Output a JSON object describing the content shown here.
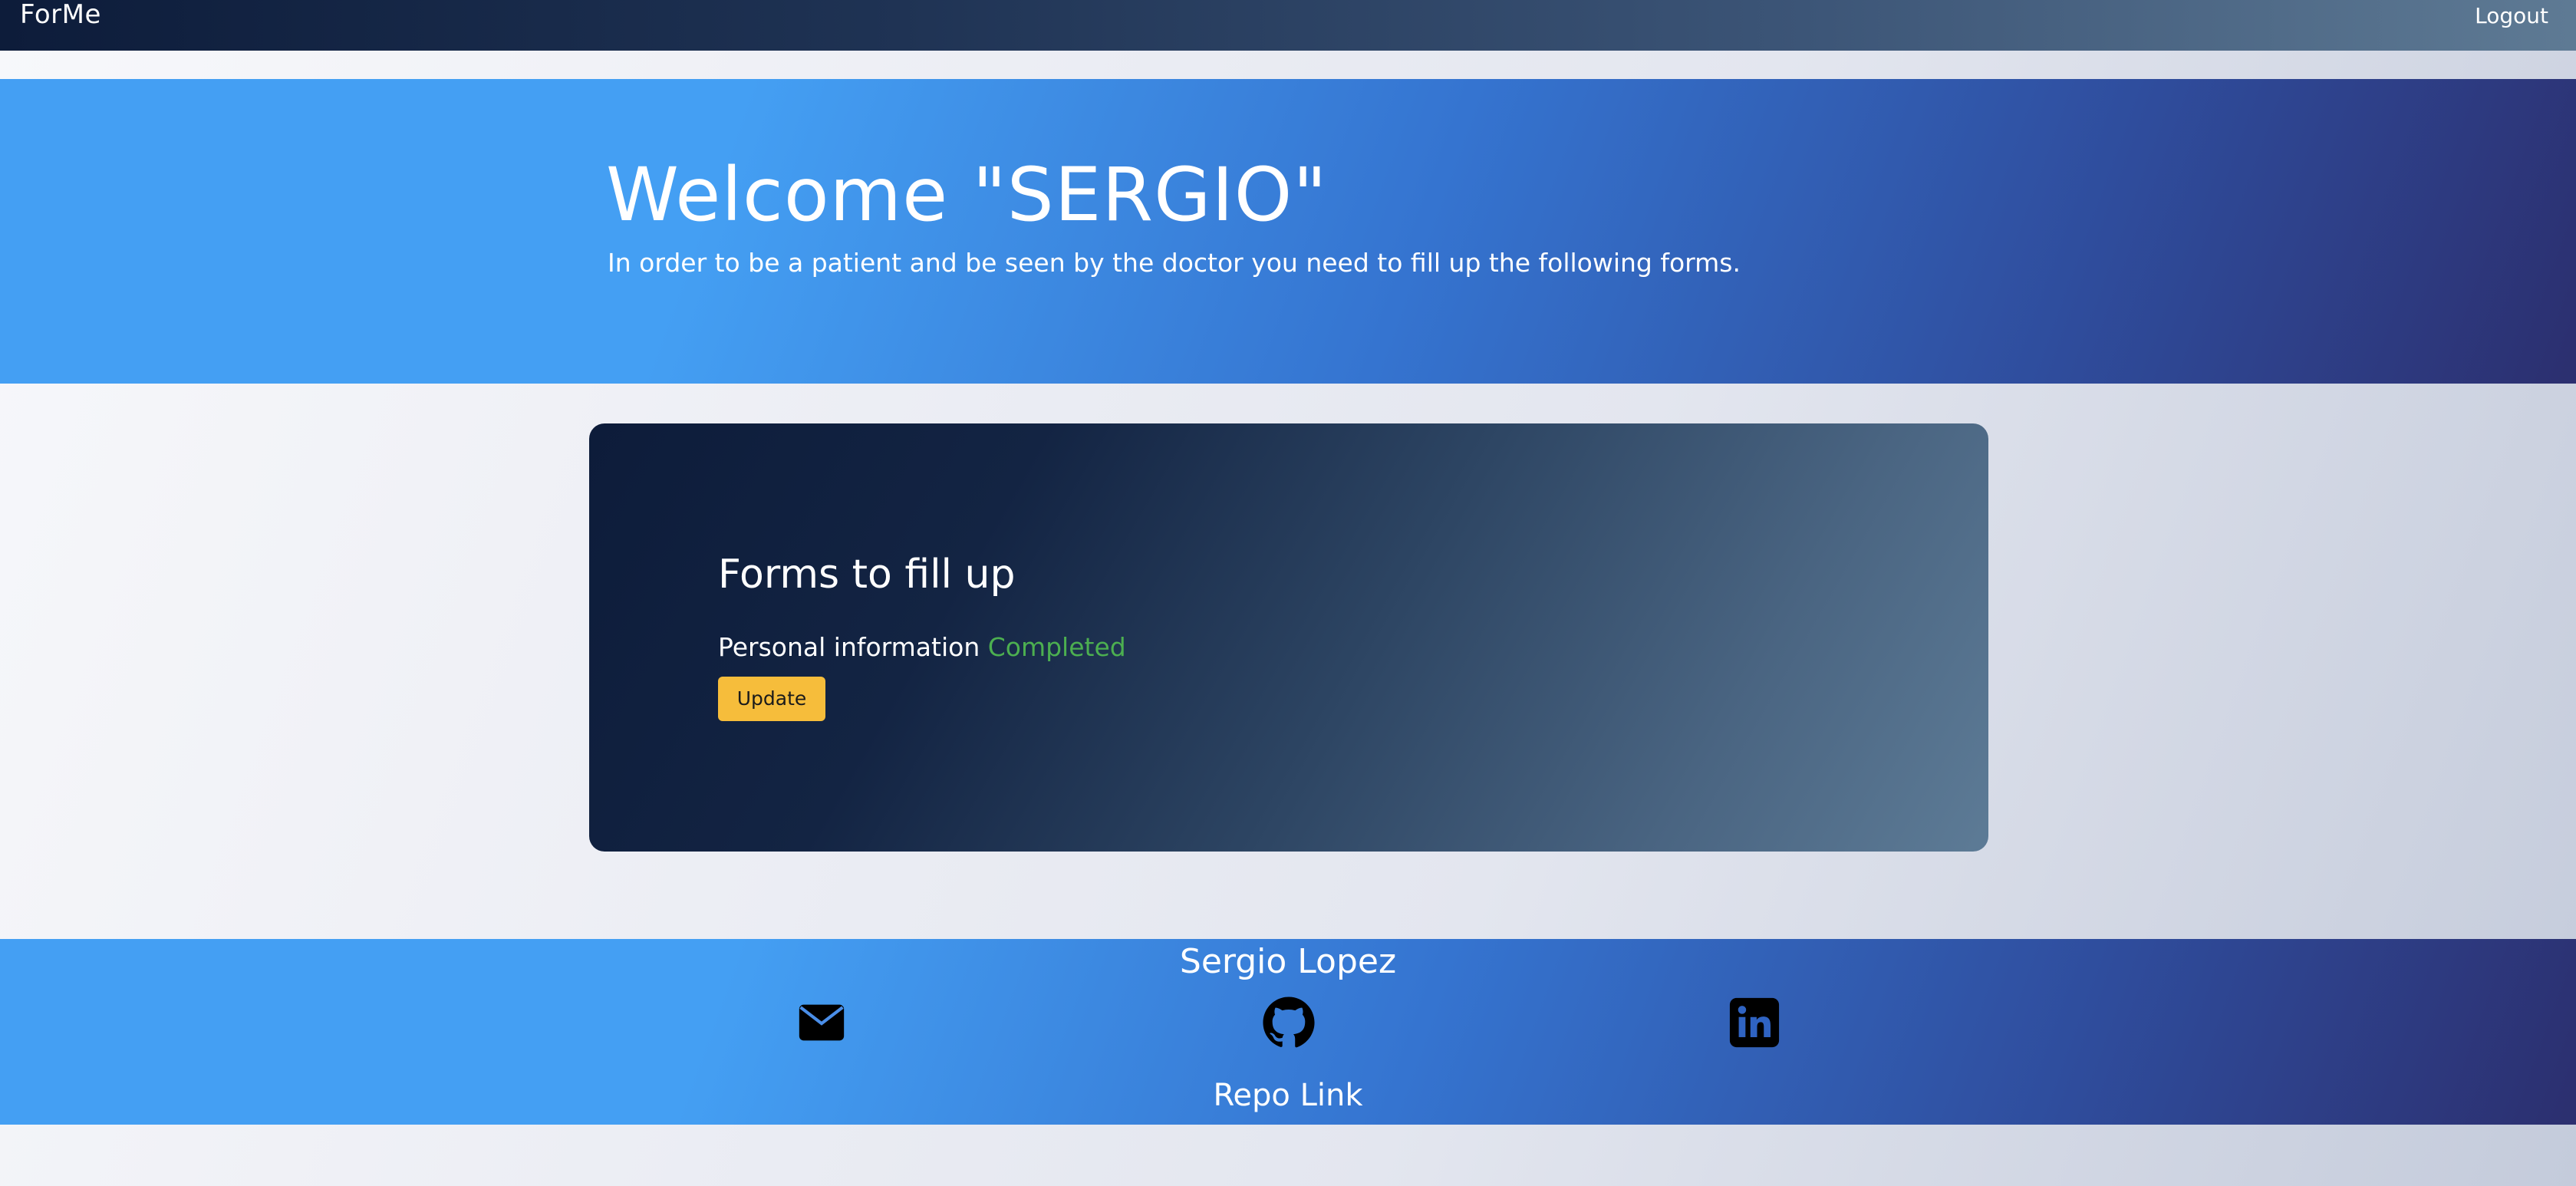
{
  "navbar": {
    "brand": "ForMe",
    "logout_label": "Logout"
  },
  "hero": {
    "title": "Welcome \"SERGIO\"",
    "subtitle": "In order to be a patient and be seen by the doctor you need to fill up the following forms."
  },
  "forms_card": {
    "title": "Forms to fill up",
    "items": [
      {
        "label": "Personal information",
        "status": "Completed",
        "status_color": "#4caf50",
        "button_label": "Update"
      }
    ]
  },
  "footer": {
    "name": "Sergio Lopez",
    "icons": [
      "mail-icon",
      "github-icon",
      "linkedin-icon"
    ],
    "repo_link": "Repo Link"
  },
  "colors": {
    "accent_blue": "#449ff3",
    "navy": "#0d1c3a",
    "button_yellow": "#f6bd3b"
  }
}
